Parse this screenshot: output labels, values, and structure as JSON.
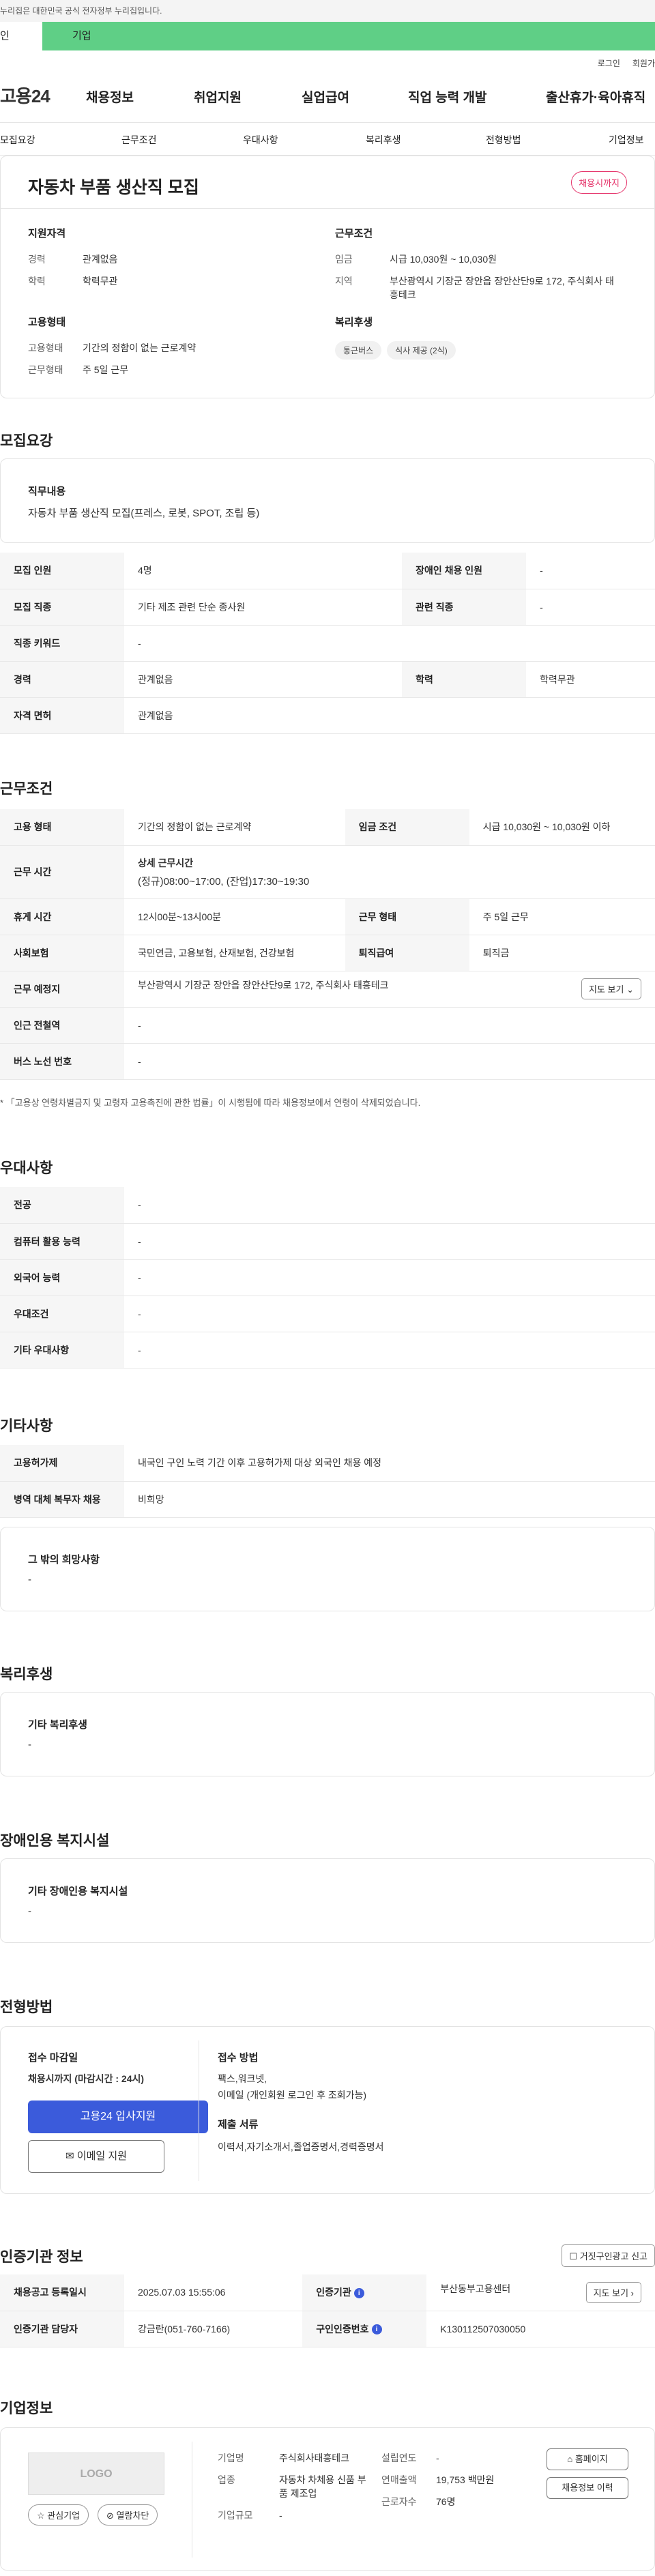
{
  "gov_banner": "누리집은 대한민국 공식 전자정부 누리집입니다.",
  "tabs": [
    "인",
    "기업"
  ],
  "util": [
    "로그인",
    "회원가"
  ],
  "logo": "고용24",
  "gnb": [
    "채용정보",
    "취업지원",
    "실업급여",
    "직업 능력 개발",
    "출산휴가·육아휴직"
  ],
  "subnav": [
    "모집요강",
    "근무조건",
    "우대사항",
    "복리후생",
    "전형방법",
    "기업정보"
  ],
  "job": {
    "title": "자동차 부품 생산직 모집",
    "badge": "채용시까지",
    "qual_title": "지원자격",
    "qual": [
      {
        "k": "경력",
        "v": "관계없음"
      },
      {
        "k": "학력",
        "v": "학력무관"
      }
    ],
    "cond_title": "근무조건",
    "cond": [
      {
        "k": "임금",
        "v": "시급 10,030원 ~ 10,030원"
      },
      {
        "k": "지역",
        "v": "부산광역시 기장군 장안읍 장안산단9로 172, 주식회사 태흥테크"
      }
    ],
    "emp_title": "고용형태",
    "emp": [
      {
        "k": "고용형태",
        "v": "기간의 정함이 없는 근로계약"
      },
      {
        "k": "근무형태",
        "v": "주 5일 근무"
      }
    ],
    "welfare_title": "복리후생",
    "welfare_chips": [
      "통근버스",
      "식사 제공 (2식)"
    ]
  },
  "recruit": {
    "title": "모집요강",
    "duty_label": "직무내용",
    "duty": "자동차 부품 생산직 모집(프레스, 로봇, SPOT, 조립 등)",
    "rows": [
      [
        "모집 인원",
        "4명",
        "장애인 채용 인원",
        "-"
      ],
      [
        "모집 직종",
        "기타 제조 관련 단순 종사원",
        "관련 직종",
        "-"
      ],
      [
        "직종 키워드",
        "-"
      ],
      [
        "경력",
        "관계없음",
        "학력",
        "학력무관"
      ],
      [
        "자격 면허",
        "관계없음"
      ]
    ]
  },
  "work": {
    "title": "근무조건",
    "r1": [
      "고용 형태",
      "기간의 정함이 없는 근로계약",
      "임금 조건",
      "시급 10,030원 ~ 10,030원 이하"
    ],
    "r2_label": "근무 시간",
    "r2_sub": "상세 근무시간",
    "r2_val": "(정규)08:00~17:00, (잔업)17:30~19:30",
    "r3": [
      "휴게 시간",
      "12시00분~13시00분",
      "근무 형태",
      "주 5일 근무"
    ],
    "r4": [
      "사회보험",
      "국민연금, 고용보험, 산재보험, 건강보험",
      "퇴직급여",
      "퇴직금"
    ],
    "r5": [
      "근무 예정지",
      "부산광역시 기장군 장안읍 장안산단9로 172, 주식회사 태흥테크"
    ],
    "map_btn": "지도 보기",
    "r6": [
      "인근 전철역",
      "-"
    ],
    "r7": [
      "버스 노선 번호",
      "-"
    ],
    "note": "* 「고용상 연령차별금지 및 고령자 고용촉진에 관한 법률」이 시행됨에 따라 채용정보에서 연령이 삭제되었습니다."
  },
  "pref": {
    "title": "우대사항",
    "rows": [
      [
        "전공",
        "-"
      ],
      [
        "컴퓨터 활용 능력",
        "-"
      ],
      [
        "외국어 능력",
        "-"
      ],
      [
        "우대조건",
        "-"
      ],
      [
        "기타 우대사항",
        "-"
      ]
    ]
  },
  "etc": {
    "title": "기타사항",
    "rows": [
      [
        "고용허가제",
        "내국인 구인 노력 기간 이후 고용허가제 대상 외국인 채용 예정"
      ],
      [
        "병역 대체 복무자 채용",
        "비희망"
      ]
    ],
    "other_label": "그 밖의 희망사항",
    "other_val": "-"
  },
  "benefit": {
    "title": "복리후생",
    "label": "기타 복리후생",
    "val": "-"
  },
  "disabled": {
    "title": "장애인용 복지시설",
    "label": "기타 장애인용 복지시설",
    "val": "-"
  },
  "process": {
    "title": "전형방법",
    "deadline_label": "접수 마감일",
    "deadline_val": "채용시까지 (마감시간 : 24시)",
    "apply_btn": "고용24 입사지원",
    "email_btn": "이메일 지원",
    "method_label": "접수 방법",
    "method_val1": "팩스,워크넷,",
    "method_val2": "이메일 (개인회원 로그인 후 조회가능)",
    "docs_label": "제출 서류",
    "docs_val": "이력서,자기소개서,졸업증명서,경력증명서"
  },
  "cert": {
    "title": "인증기관 정보",
    "report_btn": "거짓구인광고 신고",
    "r1": [
      "채용공고 등록일시",
      "2025.07.03 15:55:06",
      "인증기관",
      "부산동부고용센터"
    ],
    "map_btn": "지도 보기",
    "r2": [
      "인증기관 담당자",
      "강금란(051-760-7166)",
      "구인인증번호",
      "K130112507030050"
    ]
  },
  "company": {
    "title": "기업정보",
    "logo": "LOGO",
    "fav_btn": "관심기업",
    "block_btn": "열람차단",
    "name_k": "기업명",
    "name_v": "주식회사태흥테크",
    "ind_k": "업종",
    "ind_v": "자동차 차체용 신품 부품 제조업",
    "size_k": "기업규모",
    "size_v": "-",
    "year_k": "설립연도",
    "year_v": "-",
    "sales_k": "연매출액",
    "sales_v": "19,753 백만원",
    "emp_k": "근로자수",
    "emp_v": "76명",
    "home_btn": "홈페이지",
    "jobs_btn": "채용정보 이력"
  }
}
